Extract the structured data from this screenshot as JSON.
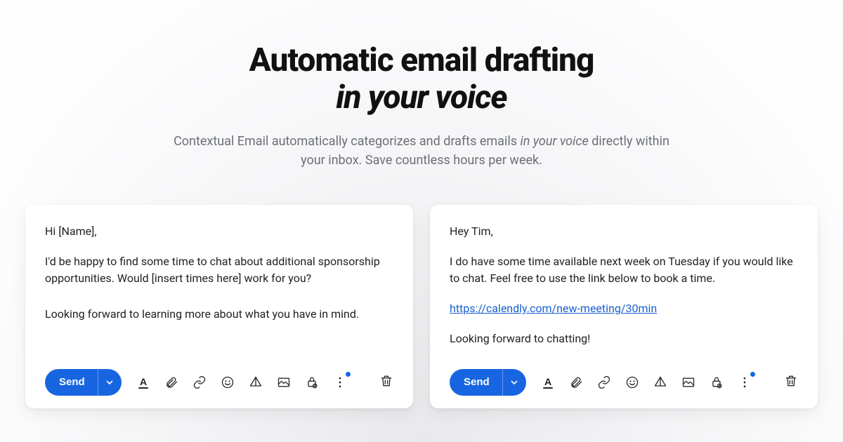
{
  "hero": {
    "title_line1": "Automatic email drafting",
    "title_line2": "in your voice",
    "lead_before": "Contextual Email automatically categorizes and drafts emails ",
    "lead_italic": "in your voice",
    "lead_after": " directly within your inbox. Save countless hours per week."
  },
  "cards": [
    {
      "greeting": "Hi [Name],",
      "para1": "I'd be happy to find some time to chat about additional sponsorship opportunities. Would [insert times here] work for you?",
      "para2": "Looking forward to learning more about what you have in mind.",
      "link": null
    },
    {
      "greeting": "Hey Tim,",
      "para1": "I do have some time available next week on Tuesday if you would like to chat. Feel free to use the link below to book a time.",
      "link": "https://calendly.com/new-meeting/30min",
      "para2": "Looking forward to chatting!"
    }
  ],
  "toolbar": {
    "send_label": "Send"
  }
}
